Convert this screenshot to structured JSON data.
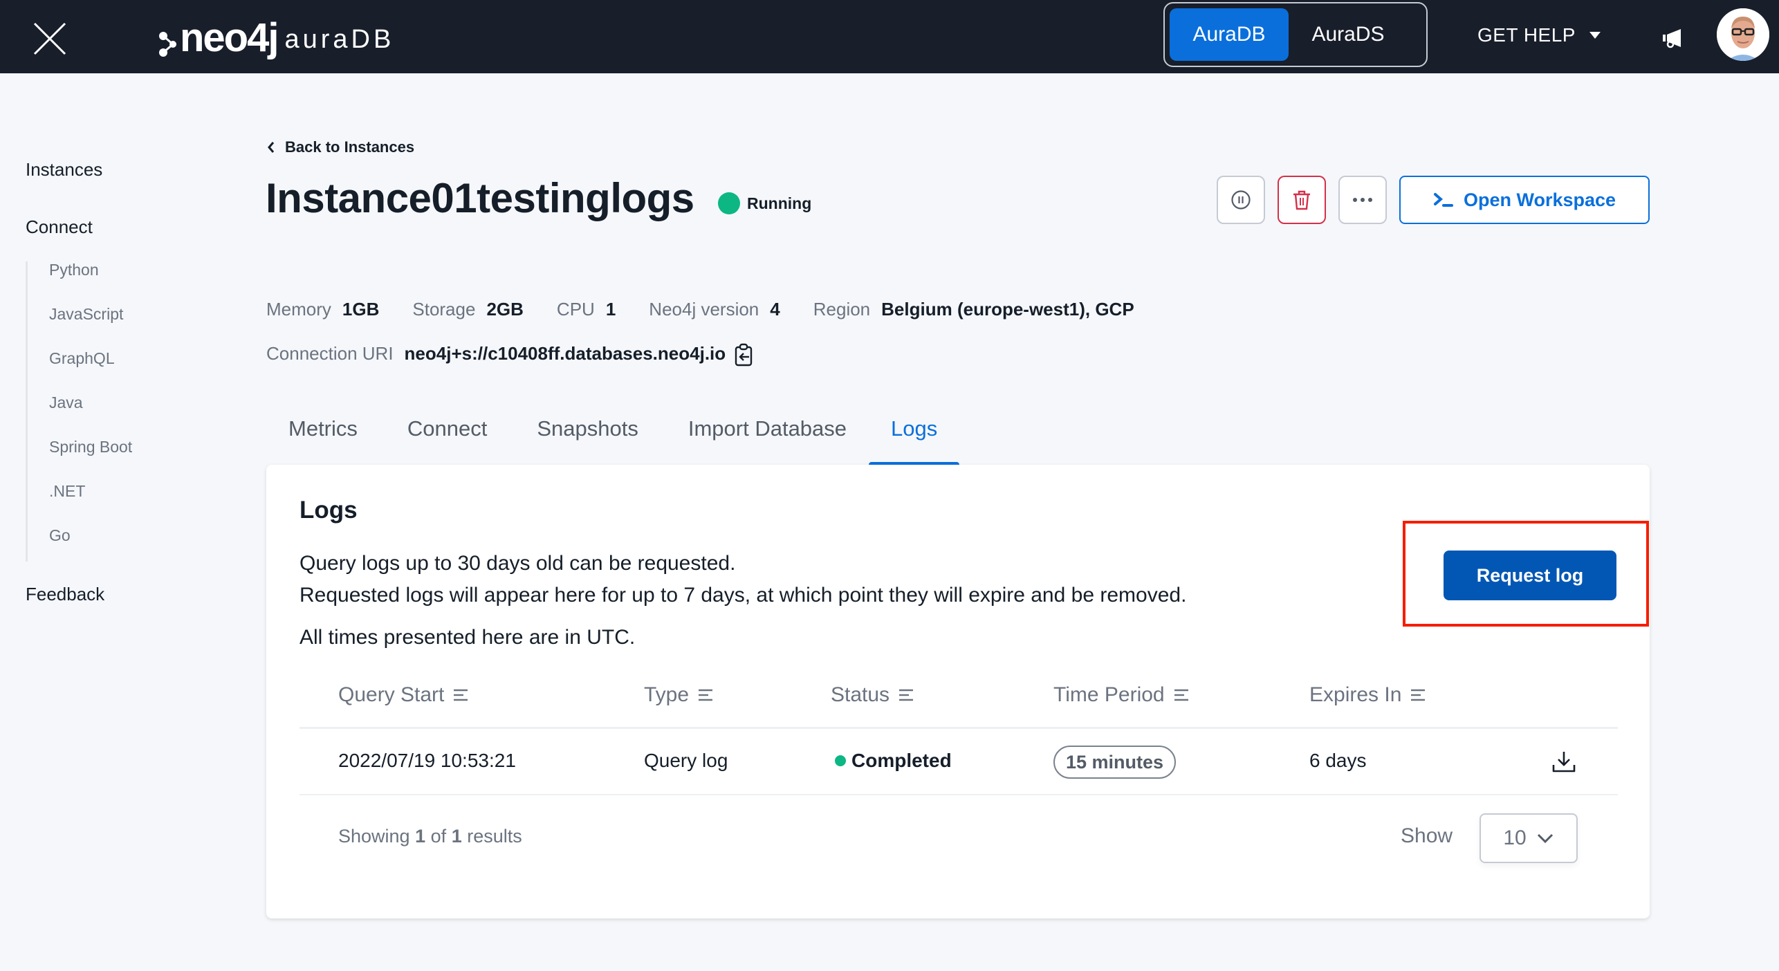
{
  "topbar": {
    "logo_brand": "neo4j",
    "logo_product": "auraDB",
    "product_toggle": [
      {
        "label": "AuraDB",
        "active": true
      },
      {
        "label": "AuraDS",
        "active": false
      }
    ],
    "get_help_label": "GET HELP",
    "colors": {
      "background": "#181e2a",
      "toggle_active": "#0a6fdb"
    }
  },
  "sidebar": {
    "items": [
      {
        "label": "Instances"
      },
      {
        "label": "Connect",
        "children": [
          "Python",
          "JavaScript",
          "GraphQL",
          "Java",
          "Spring Boot",
          ".NET",
          "Go"
        ]
      },
      {
        "label": "Feedback"
      }
    ]
  },
  "instance": {
    "back_label": "Back to Instances",
    "name": "Instance01testinglogs",
    "status": "Running",
    "status_color": "#0cb784",
    "actions": {
      "pause": "pause-icon",
      "delete": "trash-icon",
      "more": "more-icon",
      "open_workspace_label": "Open Workspace"
    },
    "meta": [
      {
        "label": "Memory",
        "value": "1GB"
      },
      {
        "label": "Storage",
        "value": "2GB"
      },
      {
        "label": "CPU",
        "value": "1"
      },
      {
        "label": "Neo4j version",
        "value": "4"
      },
      {
        "label": "Region",
        "value": "Belgium (europe-west1), GCP"
      }
    ],
    "connection_uri_label": "Connection URI",
    "connection_uri": "neo4j+s://c10408ff.databases.neo4j.io"
  },
  "tabs": [
    {
      "label": "Metrics",
      "active": false
    },
    {
      "label": "Connect",
      "active": false
    },
    {
      "label": "Snapshots",
      "active": false
    },
    {
      "label": "Import Database",
      "active": false
    },
    {
      "label": "Logs",
      "active": true
    }
  ],
  "logs": {
    "title": "Logs",
    "description_line1": "Query logs up to 30 days old can be requested.",
    "description_line2": "Requested logs will appear here for up to 7 days, at which point they will expire and be removed.",
    "utc_note": "All times presented here are in UTC.",
    "request_button": "Request log",
    "columns": [
      "Query Start",
      "Type",
      "Status",
      "Time Period",
      "Expires In"
    ],
    "rows": [
      {
        "query_start": "2022/07/19 10:53:21",
        "type": "Query log",
        "status": "Completed",
        "time_period": "15 minutes",
        "expires_in": "6 days"
      }
    ],
    "footer": {
      "showing_prefix": "Showing",
      "shown": "1",
      "of": "of",
      "total": "1",
      "suffix": "results",
      "show_label": "Show",
      "page_size": "10"
    },
    "highlight_color": "#f51e00",
    "button_color": "#0357b4"
  }
}
